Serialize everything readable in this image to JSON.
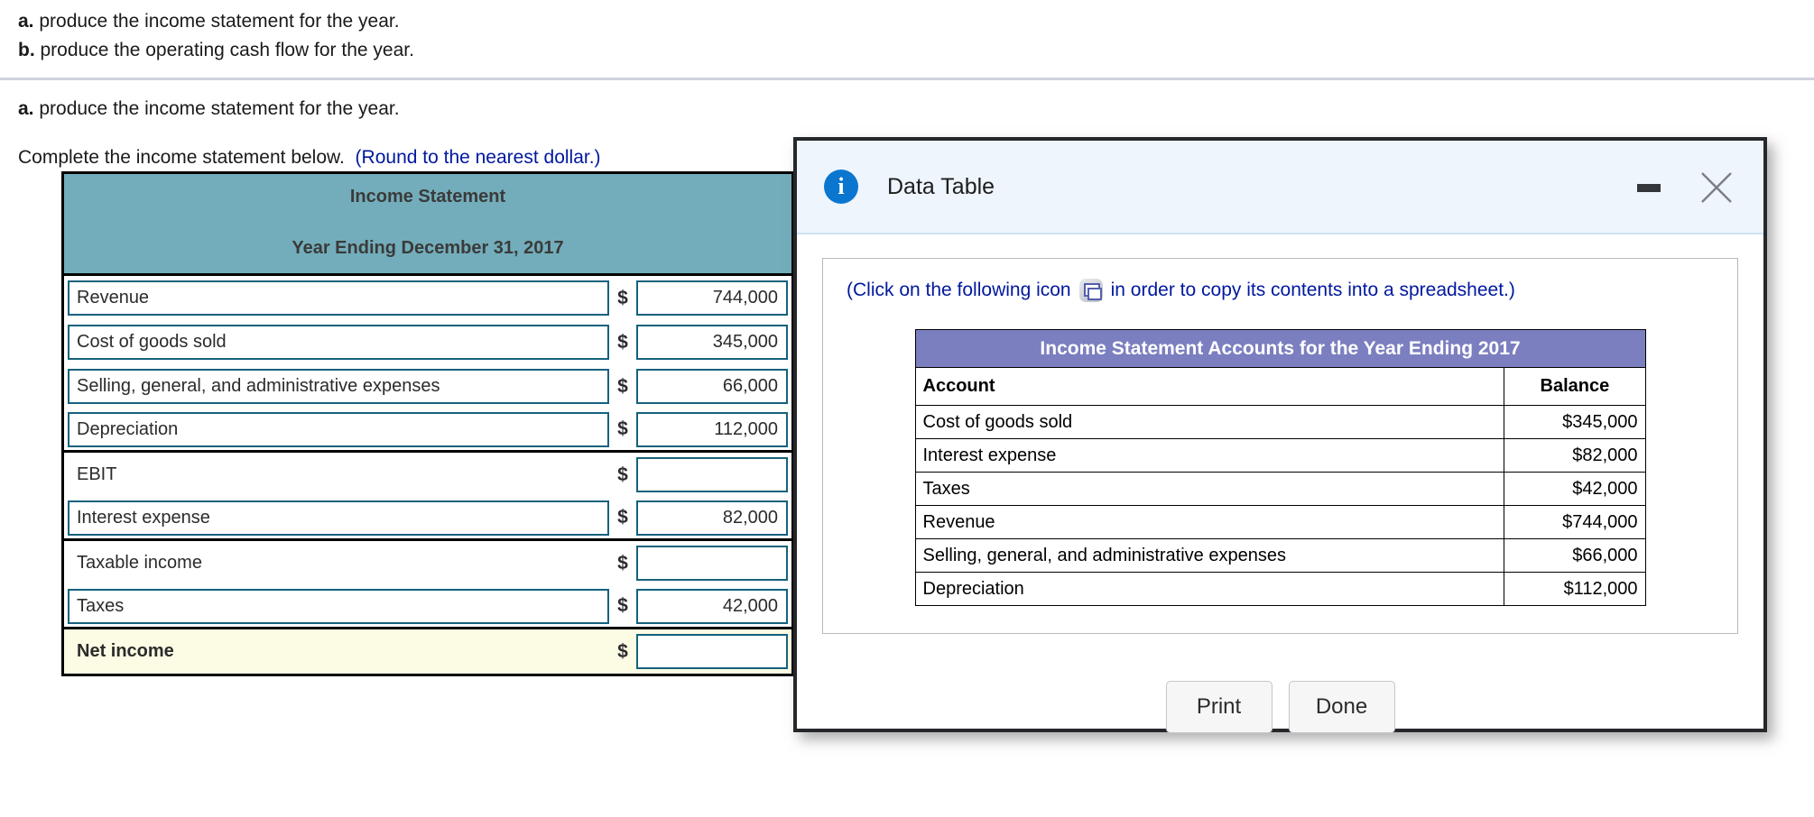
{
  "question": {
    "bullets": [
      {
        "marker": "a.",
        "text": " produce the income statement for the year."
      },
      {
        "marker": "b.",
        "text": " produce the operating cash flow for the year."
      }
    ],
    "restate_marker": "a.",
    "restate_text": " produce the income statement for the year.",
    "complete_text": "Complete the income statement below.",
    "round_note": "(Round to the nearest dollar.)"
  },
  "income_statement": {
    "title": "Income Statement",
    "subtitle": "Year Ending December 31, 2017",
    "currency_symbol": "$",
    "rows": [
      {
        "label": "Revenue",
        "value": "744,000",
        "boxed_label": true,
        "section_end": false,
        "highlight": false,
        "bold": false
      },
      {
        "label": "Cost of goods sold",
        "value": "345,000",
        "boxed_label": true,
        "section_end": false,
        "highlight": false,
        "bold": false
      },
      {
        "label": "Selling, general, and administrative expenses",
        "value": "66,000",
        "boxed_label": true,
        "section_end": false,
        "highlight": false,
        "bold": false
      },
      {
        "label": "Depreciation",
        "value": "112,000",
        "boxed_label": true,
        "section_end": true,
        "highlight": false,
        "bold": false
      },
      {
        "label": "EBIT",
        "value": "",
        "boxed_label": false,
        "section_end": false,
        "highlight": false,
        "bold": false
      },
      {
        "label": "Interest expense",
        "value": "82,000",
        "boxed_label": true,
        "section_end": true,
        "highlight": false,
        "bold": false
      },
      {
        "label": "Taxable income",
        "value": "",
        "boxed_label": false,
        "section_end": false,
        "highlight": false,
        "bold": false
      },
      {
        "label": "Taxes",
        "value": "42,000",
        "boxed_label": true,
        "section_end": true,
        "highlight": false,
        "bold": false
      },
      {
        "label": "Net income",
        "value": "",
        "boxed_label": false,
        "section_end": false,
        "highlight": true,
        "bold": true
      }
    ]
  },
  "dialog": {
    "title": "Data Table",
    "info_icon_glyph": "i",
    "minimize_label": "",
    "close_glyph": "×",
    "click_note_before": "(Click on the following icon",
    "click_note_after": "in order to copy its contents into a spreadsheet.)",
    "buttons": [
      {
        "label": "Print"
      },
      {
        "label": "Done"
      }
    ],
    "table": {
      "title": "Income Statement Accounts for the Year Ending 2017",
      "columns": [
        "Account",
        "Balance"
      ],
      "rows": [
        {
          "account": "Cost of goods sold",
          "balance": "$345,000"
        },
        {
          "account": "Interest expense",
          "balance": "$82,000"
        },
        {
          "account": "Taxes",
          "balance": "$42,000"
        },
        {
          "account": "Revenue",
          "balance": "$744,000"
        },
        {
          "account": "Selling, general, and administrative expenses",
          "balance": "$66,000"
        },
        {
          "account": "Depreciation",
          "balance": "$112,000"
        }
      ]
    }
  },
  "colors": {
    "statement_header_bg": "#73adbb",
    "input_border": "#15627d",
    "net_income_bg": "#fcfbe3",
    "dialog_title_bg": "#eef5fd",
    "dialog_table_header_bg": "#7b7fc0",
    "note_text": "#00189e",
    "info_icon_bg": "#0a76d0"
  }
}
